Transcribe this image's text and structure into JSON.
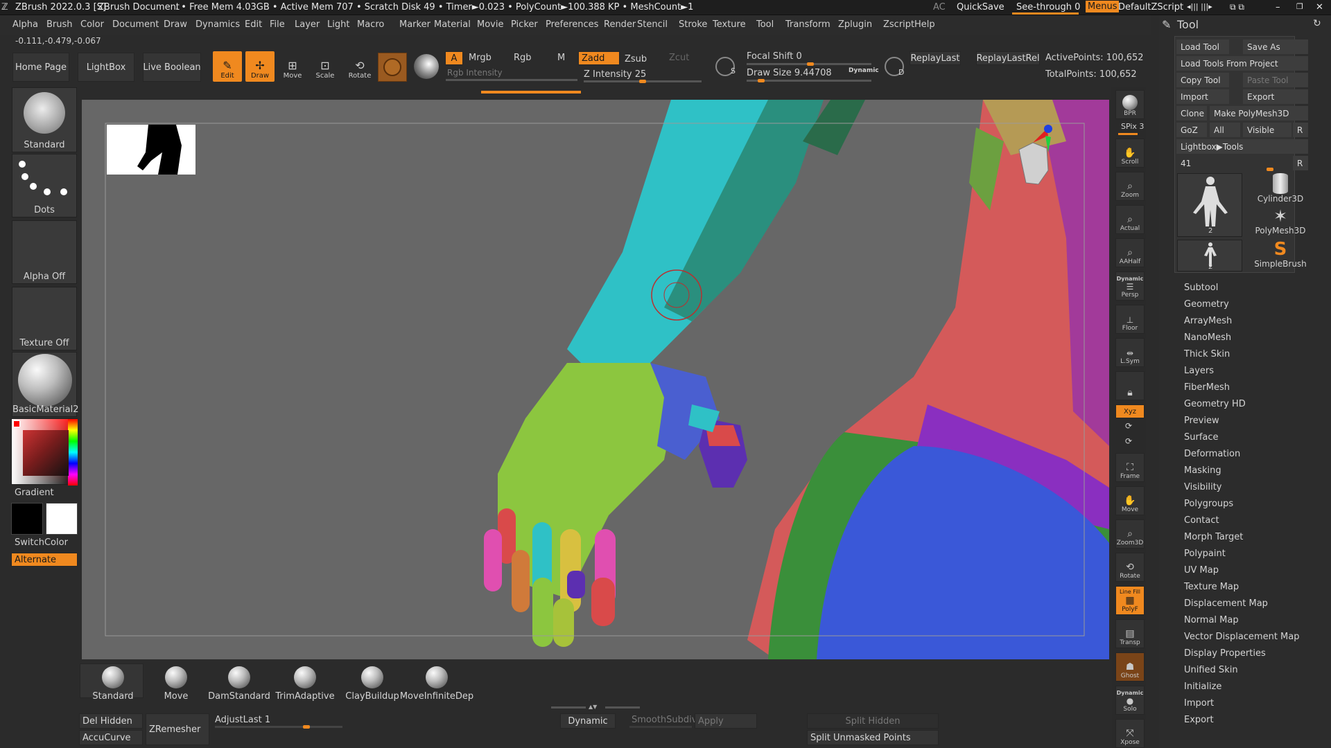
{
  "titlebar": {
    "app": "ZBrush 2022.0.3 [S]",
    "document": "ZBrush Document",
    "stats": ". • Free Mem 4.03GB • Active Mem 707 • Scratch Disk 49 • Timer►0.023 • PolyCount►100.388 KP • MeshCount►1",
    "ac": "AC",
    "quicksave": "QuickSave",
    "seethrough": "See-through  0",
    "menus": "Menus",
    "script": "DefaultZScript"
  },
  "menubar": [
    "Alpha",
    "Brush",
    "Color",
    "Document",
    "Draw",
    "Dynamics",
    "Edit",
    "File",
    "Layer",
    "Light",
    "Macro",
    "Marker",
    "Material",
    "Movie",
    "Picker",
    "Preferences",
    "Render",
    "Stencil",
    "Stroke",
    "Texture",
    "Tool",
    "Transform",
    "Zplugin",
    "Zscript",
    "Help"
  ],
  "coords": "-0.111,-0.479,-0.067",
  "shelf": {
    "home": "Home Page",
    "lightbox": "LightBox",
    "liveboolean": "Live Boolean",
    "edit": "Edit",
    "draw": "Draw",
    "move": "Move",
    "scale": "Scale",
    "rotate": "Rotate",
    "a": "A",
    "mrgb": "Mrgb",
    "rgb": "Rgb",
    "m": "M",
    "zadd": "Zadd",
    "zsub": "Zsub",
    "zcut": "Zcut",
    "rgb_intensity": "Rgb Intensity",
    "z_intensity": "Z Intensity 25",
    "focal_shift": "Focal Shift 0",
    "draw_size": "Draw Size 9.44708",
    "dynamic": "Dynamic",
    "replaylast": "ReplayLast",
    "replaylastrel": "ReplayLastRel",
    "activepoints": "ActivePoints: 100,652",
    "totalpoints": "TotalPoints: 100,652",
    "s": "S",
    "d": "D"
  },
  "left": {
    "brush": "Standard",
    "stroke": "Dots",
    "alpha": "Alpha Off",
    "texture": "Texture Off",
    "material": "BasicMaterial2",
    "gradient": "Gradient",
    "switchcolor": "SwitchColor",
    "alternate": "Alternate"
  },
  "dock": [
    "BPR",
    "SPix 3",
    "Scroll",
    "Zoom",
    "Actual",
    "AAHalf",
    "Persp",
    "Floor",
    "L.Sym",
    "",
    "Xyz",
    "",
    "",
    "Frame",
    "Move",
    "Zoom3D",
    "Rotate",
    "PolyF",
    "Transp",
    "Ghost",
    "Solo",
    "Xpose"
  ],
  "dock_labels": {
    "dynamic_persp": "Dynamic",
    "line_fill": "Line Fill",
    "dynamic_solo": "Dynamic"
  },
  "tool": {
    "title": "Tool",
    "load_tool": "Load Tool",
    "save_as": "Save As",
    "load_from_project": "Load Tools From Project",
    "copy_tool": "Copy Tool",
    "paste_tool": "Paste Tool",
    "import": "Import",
    "export": "Export",
    "clone": "Clone",
    "make_polymesh": "Make PolyMesh3D",
    "goz": "GoZ",
    "all": "All",
    "visible": "Visible",
    "r": "R",
    "lightbox_tools": "Lightbox▶Tools",
    "count": "41",
    "r2": "R",
    "thumb_num1": "2",
    "thumb_num2": "2",
    "cylinder": "Cylinder3D",
    "polymesh": "PolyMesh3D",
    "simplebrush": "SimpleBrush",
    "menu": [
      "Subtool",
      "Geometry",
      "ArrayMesh",
      "NanoMesh",
      "Thick Skin",
      "Layers",
      "FiberMesh",
      "Geometry HD",
      "Preview",
      "Surface",
      "Deformation",
      "Masking",
      "Visibility",
      "Polygroups",
      "Contact",
      "Morph Target",
      "Polypaint",
      "UV Map",
      "Texture Map",
      "Displacement Map",
      "Normal Map",
      "Vector Displacement Map",
      "Display Properties",
      "Unified Skin",
      "Initialize",
      "Import",
      "Export"
    ]
  },
  "bottom": {
    "brushes": [
      "Standard",
      "Move",
      "DamStandard",
      "TrimAdaptive",
      "ClayBuildup",
      "MoveInfiniteDep"
    ],
    "del_hidden": "Del Hidden",
    "accucurve": "AccuCurve",
    "zremesher": "ZRemesher",
    "adjustlast": "AdjustLast 1",
    "dynamic": "Dynamic",
    "smoothsubdiv": "SmoothSubdiv",
    "apply": "Apply",
    "split_hidden": "Split Hidden",
    "split_unmasked": "Split Unmasked Points"
  },
  "colors": {
    "accent": "#f0891f",
    "bg": "#2b2b2b",
    "viewport": "#676767"
  }
}
